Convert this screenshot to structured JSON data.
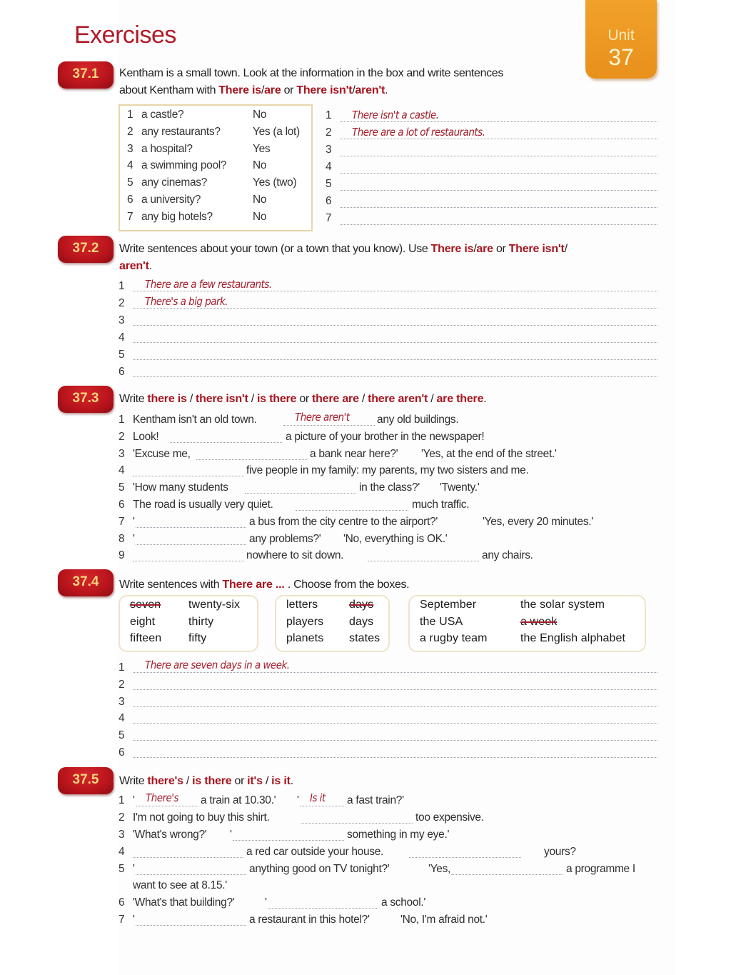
{
  "page": {
    "title": "Exercises",
    "unit_label": "Unit",
    "unit_number": "37",
    "colors": {
      "accent_red": "#b01a26",
      "answer_red": "#a31d2b",
      "badge_gold_text": "#f6d67a",
      "unit_tab_orange": "#ec961f"
    }
  },
  "ex1": {
    "badge": "37.1",
    "instr_a": "Kentham is a small town.  Look at the information in the box and write sentences",
    "instr_b": "about Kentham with ",
    "hl1": "There is",
    "sep1": "/",
    "hl2": "are",
    "or": " or ",
    "hl3": "There isn't",
    "sep2": "/",
    "hl4": "aren't",
    "end": ".",
    "box": [
      {
        "n": "1",
        "q": "a castle?",
        "a": "No"
      },
      {
        "n": "2",
        "q": "any restaurants?",
        "a": "Yes (a lot)"
      },
      {
        "n": "3",
        "q": "a hospital?",
        "a": "Yes"
      },
      {
        "n": "4",
        "q": "a swimming pool?",
        "a": "No"
      },
      {
        "n": "5",
        "q": "any cinemas?",
        "a": "Yes (two)"
      },
      {
        "n": "6",
        "q": "a university?",
        "a": "No"
      },
      {
        "n": "7",
        "q": "any big hotels?",
        "a": "No"
      }
    ],
    "answers": [
      {
        "n": "1",
        "text": "There isn't a castle."
      },
      {
        "n": "2",
        "text": "There are a lot of restaurants."
      },
      {
        "n": "3",
        "text": ""
      },
      {
        "n": "4",
        "text": ""
      },
      {
        "n": "5",
        "text": ""
      },
      {
        "n": "6",
        "text": ""
      },
      {
        "n": "7",
        "text": ""
      }
    ]
  },
  "ex2": {
    "badge": "37.2",
    "instr_a": "Write sentences about your town (or a town that you know).  Use ",
    "hl1": "There is",
    "sep1": "/",
    "hl2": "are",
    "or": " or ",
    "hl3": "There isn't",
    "sep2": "/",
    "hl4": "aren't",
    "end": ".",
    "answers": [
      {
        "n": "1",
        "text": "There are a few restaurants."
      },
      {
        "n": "2",
        "text": "There's a big park."
      },
      {
        "n": "3",
        "text": ""
      },
      {
        "n": "4",
        "text": ""
      },
      {
        "n": "5",
        "text": ""
      },
      {
        "n": "6",
        "text": ""
      }
    ]
  },
  "ex3": {
    "badge": "37.3",
    "instr_write": "Write ",
    "hl1": "there is",
    "s1": " / ",
    "hl2": "there isn't",
    "s2": " / ",
    "hl3": "is there",
    "or": " or ",
    "hl4": "there are",
    "s3": " / ",
    "hl5": "there aren't",
    "s4": " / ",
    "hl6": "are there",
    "end": ".",
    "items": [
      {
        "n": "1",
        "t1": "Kentham isn't an old town.",
        "answer": "There aren't",
        "t2": "any old buildings."
      },
      {
        "n": "2",
        "t1": "Look!",
        "t2": "a picture of your brother in the newspaper!"
      },
      {
        "n": "3",
        "t1": "'Excuse me,",
        "t2": "a bank near here?'",
        "t3": "'Yes, at the end of the street.'"
      },
      {
        "n": "4",
        "t2": "five people in my family: my parents, my two sisters and me."
      },
      {
        "n": "5",
        "t1": "'How many students",
        "t2": "in the class?'",
        "t3": "'Twenty.'"
      },
      {
        "n": "6",
        "t1": "The road is usually very quiet.",
        "t2": "much traffic."
      },
      {
        "n": "7",
        "t1": "'",
        "t2": "a bus from the city centre to the airport?'",
        "t3": "'Yes, every 20 minutes.'"
      },
      {
        "n": "8",
        "t1": "'",
        "t2": "any problems?'",
        "t3": "'No, everything is OK.'"
      },
      {
        "n": "9",
        "t2": "nowhere to sit down.",
        "t4": "any chairs."
      }
    ]
  },
  "ex4": {
    "badge": "37.4",
    "instr_a": "Write sentences with ",
    "hl1": "There are ... ",
    "instr_b": ".  Choose from the boxes.",
    "box1": [
      "seven",
      "twenty-six",
      "eight",
      "thirty",
      "fifteen",
      "fifty"
    ],
    "box2": [
      "letters",
      "days",
      "players",
      "days",
      "planets",
      "states"
    ],
    "box3": [
      "September",
      "the solar system",
      "the USA",
      "a week",
      "a rugby team",
      "the English alphabet"
    ],
    "struck": [
      "seven",
      "days",
      "a week"
    ],
    "answers": [
      {
        "n": "1",
        "text": "There are seven days in a week."
      },
      {
        "n": "2",
        "text": ""
      },
      {
        "n": "3",
        "text": ""
      },
      {
        "n": "4",
        "text": ""
      },
      {
        "n": "5",
        "text": ""
      },
      {
        "n": "6",
        "text": ""
      }
    ]
  },
  "ex5": {
    "badge": "37.5",
    "instr_write": "Write ",
    "hl1": "there's",
    "s1": " / ",
    "hl2": "is there",
    "or": " or ",
    "hl3": "it's",
    "s2": " / ",
    "hl4": "is it",
    "end": ".",
    "items": [
      {
        "n": "1",
        "q1": "'",
        "answer1": "There's",
        "t1": "a train at 10.30.'",
        "q2": "'",
        "answer2": "Is it",
        "t2": "a fast train?'"
      },
      {
        "n": "2",
        "t1": "I'm not going to buy this shirt.",
        "t2": "too expensive."
      },
      {
        "n": "3",
        "t1": "'What's wrong?'",
        "q2": "'",
        "t2": "something in my eye.'"
      },
      {
        "n": "4",
        "t1": "a red car outside your house.",
        "t2": "yours?"
      },
      {
        "n": "5",
        "q1": "'",
        "t1": "anything good on TV tonight?'",
        "t2": "'Yes,",
        "t3": "a programme I",
        "t4": "want to see at 8.15.'"
      },
      {
        "n": "6",
        "t1": "'What's that building?'",
        "q2": "'",
        "t2": "a school.'"
      },
      {
        "n": "7",
        "q1": "'",
        "t1": "a restaurant in this hotel?'",
        "t2": "'No, I'm afraid not.'"
      }
    ]
  }
}
